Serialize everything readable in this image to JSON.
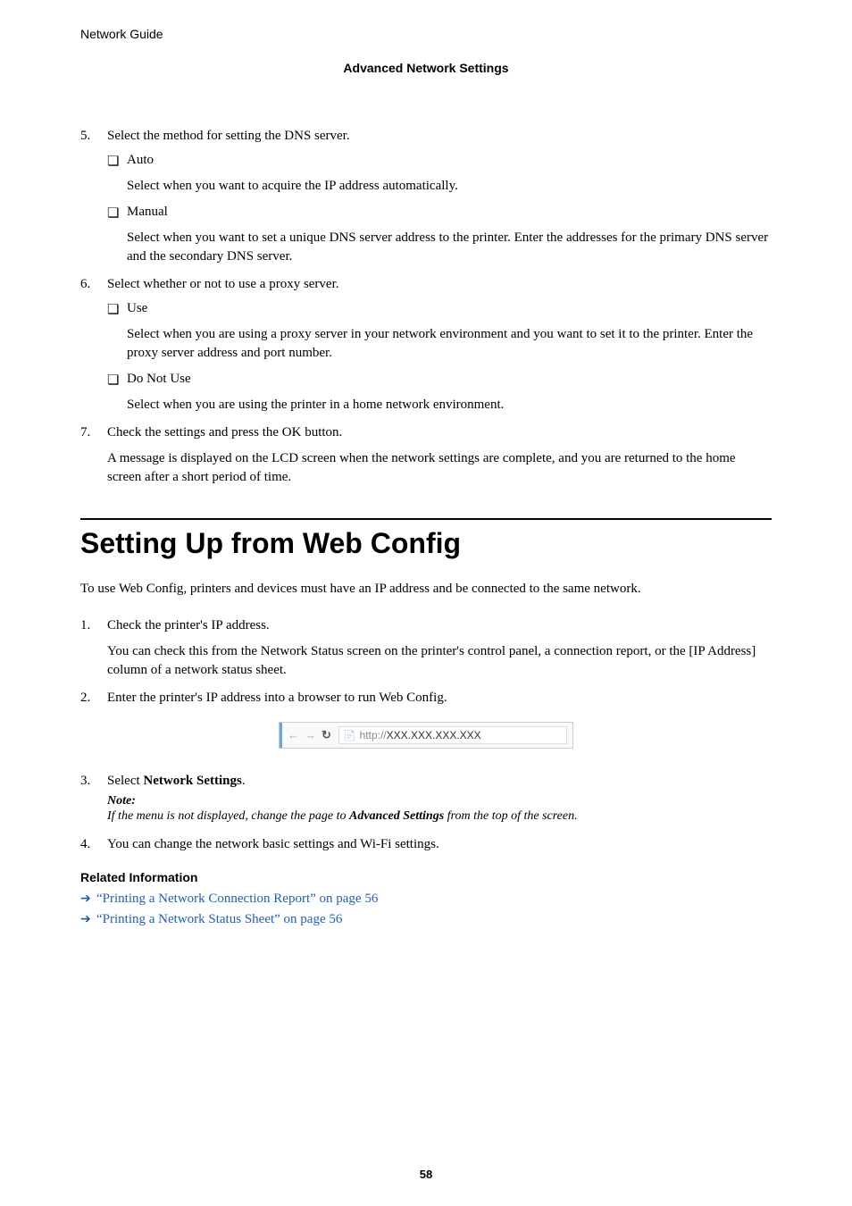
{
  "header": {
    "doc_title": "Network Guide",
    "section_title": "Advanced Network Settings"
  },
  "step5": {
    "num": "5.",
    "text": "Select the method for setting the DNS server.",
    "bullets": [
      {
        "label": "Auto",
        "desc": "Select when you want to acquire the IP address automatically."
      },
      {
        "label": "Manual",
        "desc": "Select when you want to set a unique DNS server address to the printer. Enter the addresses for the primary DNS server and the secondary DNS server."
      }
    ]
  },
  "step6": {
    "num": "6.",
    "text": "Select whether or not to use a proxy server.",
    "bullets": [
      {
        "label": "Use",
        "desc": "Select when you are using a proxy server in your network environment and you want to set it to the printer. Enter the proxy server address and port number."
      },
      {
        "label": "Do Not Use",
        "desc": "Select when you are using the printer in a home network environment."
      }
    ]
  },
  "step7": {
    "num": "7.",
    "text": "Check the settings and press the OK button.",
    "para": "A message is displayed on the LCD screen when the network settings are complete, and you are returned to the home screen after a short period of time."
  },
  "section": {
    "title": "Setting Up from Web Config",
    "intro": "To use Web Config, printers and devices must have an IP address and be connected to the same network."
  },
  "wc_step1": {
    "num": "1.",
    "text": "Check the printer's IP address.",
    "para": "You can check this from the Network Status screen on the printer's control panel, a connection report, or the [IP Address] column of a network status sheet."
  },
  "wc_step2": {
    "num": "2.",
    "text": "Enter the printer's IP address into a browser to run Web Config."
  },
  "browser": {
    "url_prefix": "http://",
    "url_bold": "XXX.XXX.XXX.XXX"
  },
  "wc_step3": {
    "num": "3.",
    "text_prefix": "Select ",
    "text_bold": "Network Settings",
    "text_suffix": ".",
    "note_label": "Note:",
    "note_prefix": "If the menu is not displayed, change the page to ",
    "note_bold": "Advanced Settings",
    "note_suffix": " from the top of the screen."
  },
  "wc_step4": {
    "num": "4.",
    "text": "You can change the network basic settings and Wi-Fi settings."
  },
  "related": {
    "heading": "Related Information",
    "links": [
      "“Printing a Network Connection Report” on page 56",
      "“Printing a Network Status Sheet” on page 56"
    ]
  },
  "page_number": "58",
  "marks": {
    "bullet": "❏"
  }
}
